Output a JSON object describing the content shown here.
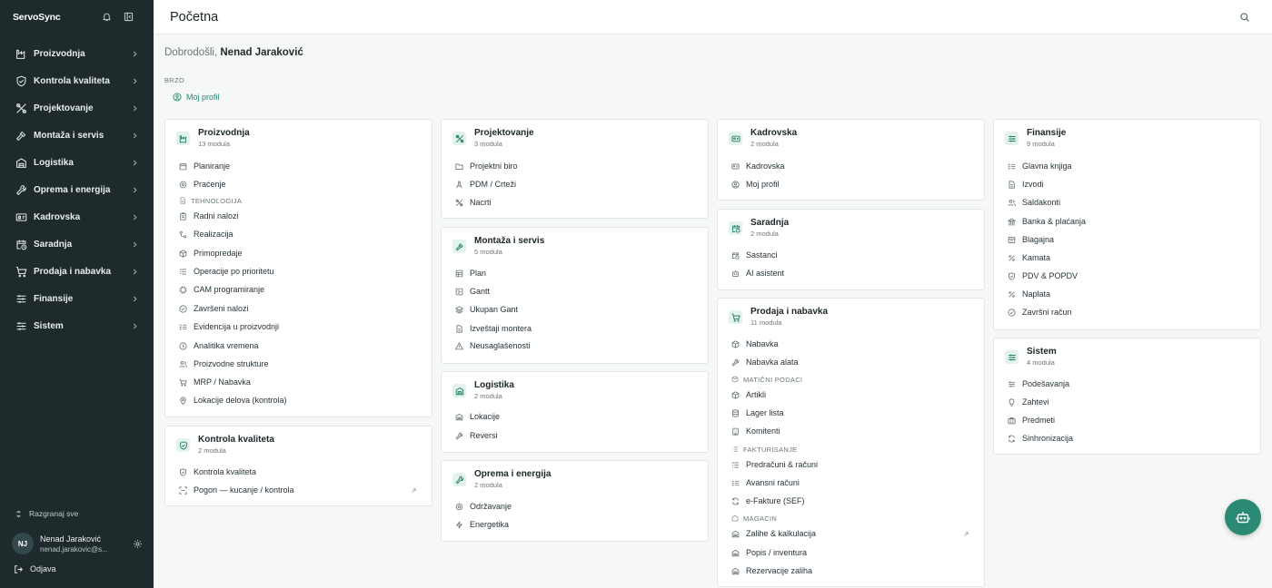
{
  "brand": "ServoSync",
  "colors": {
    "sidebar": "#1e2a2c",
    "accent": "#2b8a73",
    "accent_soft": "#e4f2ee",
    "background": "#f6f7f7"
  },
  "sidebar": {
    "items": [
      {
        "label": "Proizvodnja",
        "icon": "factory-icon"
      },
      {
        "label": "Kontrola kvaliteta",
        "icon": "shield-check-icon"
      },
      {
        "label": "Projektovanje",
        "icon": "design-tools-icon"
      },
      {
        "label": "Montaža i servis",
        "icon": "hammer-icon"
      },
      {
        "label": "Logistika",
        "icon": "warehouse-icon"
      },
      {
        "label": "Oprema i energija",
        "icon": "wrench-icon"
      },
      {
        "label": "Kadrovska",
        "icon": "id-card-icon"
      },
      {
        "label": "Saradnja",
        "icon": "calendar-clock-icon"
      },
      {
        "label": "Prodaja i nabavka",
        "icon": "cart-icon"
      },
      {
        "label": "Finansije",
        "icon": "sliders-icon"
      },
      {
        "label": "Sistem",
        "icon": "sliders-icon"
      }
    ],
    "expand_all": "Razgranaj sve",
    "user": {
      "initials": "NJ",
      "name": "Nenad Jaraković",
      "email": "nenad.jarakovic@s..."
    },
    "logout": "Odjava"
  },
  "header": {
    "title": "Početna",
    "search_icon": "search-icon"
  },
  "welcome": {
    "prefix": "Dobrodošli,",
    "name": "Nenad Jaraković"
  },
  "quick": {
    "label": "BRZO",
    "items": [
      {
        "label": "Moj profil",
        "icon": "user-circle-icon"
      }
    ]
  },
  "modules": {
    "proizvodnja": {
      "title": "Proizvodnja",
      "count": "13 modula",
      "items": [
        "Planiranje",
        "Praćenje"
      ],
      "group": "TEHNOLOGIJA",
      "group_items": [
        "Radni nalozi",
        "Realizacija",
        "Primopredaje",
        "Operacije po prioritetu",
        "CAM programiranje",
        "Završeni nalozi",
        "Evidencija u proizvodnji",
        "Analitika vremena",
        "Proizvodne strukture",
        "MRP / Nabavka",
        "Lokacije delova (kontrola)"
      ]
    },
    "kontrola": {
      "title": "Kontrola kvaliteta",
      "count": "2 modula",
      "items": [
        "Kontrola kvaliteta",
        "Pogon — kucanje / kontrola"
      ]
    },
    "projektovanje": {
      "title": "Projektovanje",
      "count": "3 modula",
      "items": [
        "Projektni biro",
        "PDM / Crteži",
        "Nacrti"
      ]
    },
    "montaza": {
      "title": "Montaža i servis",
      "count": "5 modula",
      "items": [
        "Plan",
        "Gantt",
        "Ukupan Gant",
        "Izveštaji montera",
        "Neusaglašenosti"
      ]
    },
    "logistika": {
      "title": "Logistika",
      "count": "2 modula",
      "items": [
        "Lokacije",
        "Reversi"
      ]
    },
    "oprema": {
      "title": "Oprema i energija",
      "count": "2 modula",
      "items": [
        "Održavanje",
        "Energetika"
      ]
    },
    "kadrovska": {
      "title": "Kadrovska",
      "count": "2 modula",
      "items": [
        "Kadrovska",
        "Moj profil"
      ]
    },
    "saradnja": {
      "title": "Saradnja",
      "count": "2 modula",
      "items": [
        "Sastanci",
        "AI asistent"
      ]
    },
    "prodaja": {
      "title": "Prodaja i nabavka",
      "count": "11 modula",
      "items": [
        "Nabavka",
        "Nabavka alata"
      ],
      "groups": [
        {
          "label": "MATIČNI PODACI",
          "items": [
            "Artikli",
            "Lager lista",
            "Komitenti"
          ]
        },
        {
          "label": "FAKTURISANJE",
          "items": [
            "Predračuni & računi",
            "Avansni računi",
            "e-Fakture (SEF)"
          ]
        },
        {
          "label": "MAGACIN",
          "items": [
            "Zalihe & kalkulacija",
            "Popis / inventura",
            "Rezervacije zaliha"
          ]
        }
      ]
    },
    "finansije": {
      "title": "Finansije",
      "count": "9 modula",
      "items": [
        "Glavna knjiga",
        "Izvodi",
        "Saldakonti",
        "Banka & plaćanja",
        "Blagajna",
        "Kamata",
        "PDV & POPDV",
        "Naplata",
        "Završni račun"
      ]
    },
    "sistem": {
      "title": "Sistem",
      "count": "4 modula",
      "items": [
        "Podešavanja",
        "Zahtevi",
        "Predmeti",
        "Sinhronizacija"
      ]
    }
  },
  "fab": {
    "icon": "robot-icon"
  }
}
